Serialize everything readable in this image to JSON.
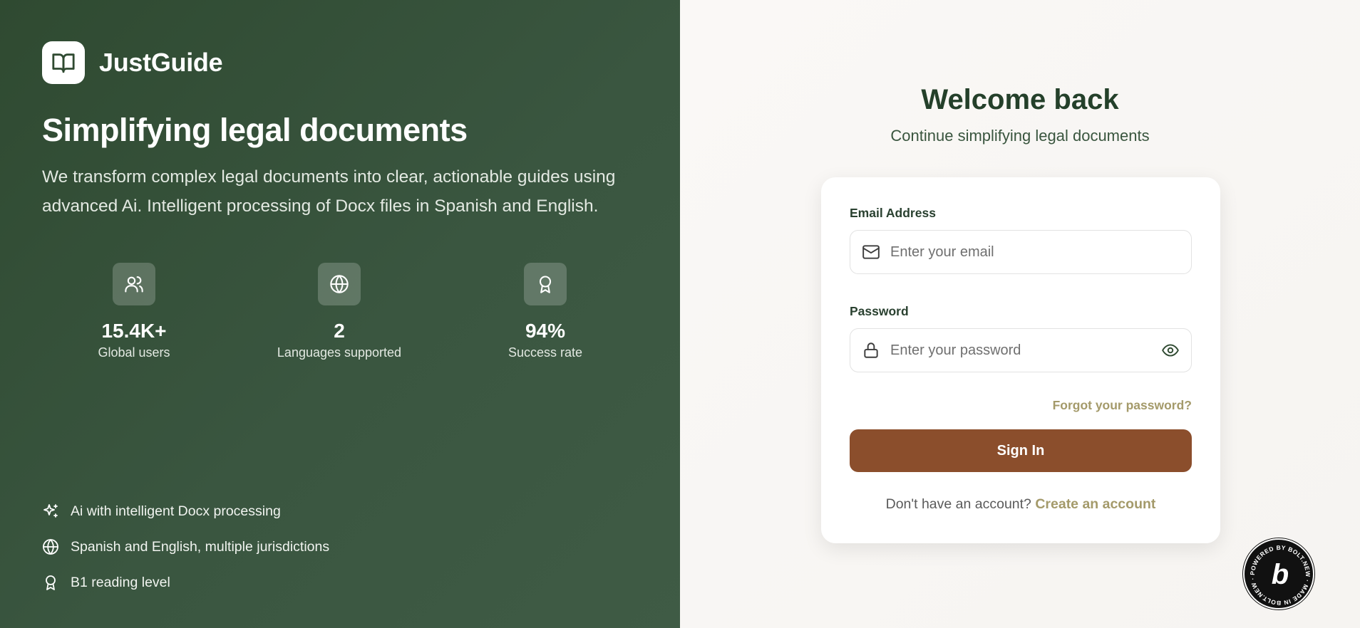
{
  "brand": {
    "name": "JustGuide",
    "logo_icon": "book-open-icon"
  },
  "hero": {
    "headline": "Simplifying legal documents",
    "description": "We transform complex legal documents into clear, actionable guides using advanced Ai. Intelligent processing of Docx files in Spanish and English."
  },
  "stats": [
    {
      "icon": "users-icon",
      "value": "15.4K+",
      "label": "Global users"
    },
    {
      "icon": "globe-icon",
      "value": "2",
      "label": "Languages supported"
    },
    {
      "icon": "award-icon",
      "value": "94%",
      "label": "Success rate"
    }
  ],
  "features": [
    {
      "icon": "sparkles-icon",
      "text": "Ai with intelligent Docx processing"
    },
    {
      "icon": "globe-icon",
      "text": "Spanish and English, multiple jurisdictions"
    },
    {
      "icon": "award-icon",
      "text": "B1 reading level"
    }
  ],
  "login": {
    "title": "Welcome back",
    "subtitle": "Continue simplifying legal documents",
    "email_label": "Email Address",
    "email_placeholder": "Enter your email",
    "email_value": "",
    "password_label": "Password",
    "password_placeholder": "Enter your password",
    "password_value": "",
    "forgot_link": "Forgot your password?",
    "submit_label": "Sign In",
    "signup_prompt": "Don't have an account?",
    "signup_link": "Create an account"
  },
  "badge": {
    "text": "POWERED BY BOLT.NEW · MADE IN BOLT.NEW ·",
    "letter": "b"
  },
  "colors": {
    "left_panel": "#2f4a31",
    "accent_button": "#8b4e2c",
    "link_gold": "#a49a6a",
    "heading_green": "#24402a"
  }
}
